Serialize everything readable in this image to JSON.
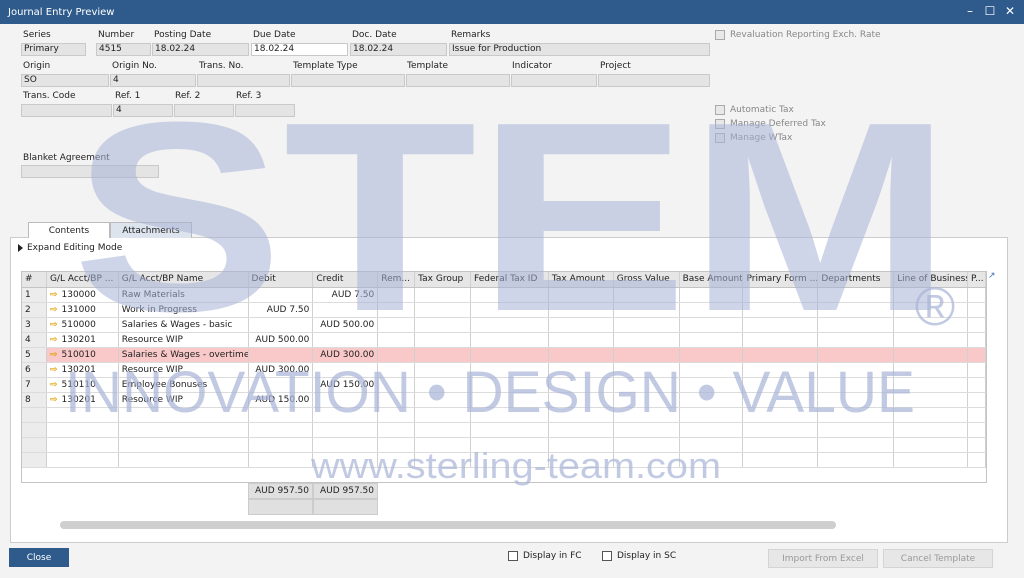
{
  "window": {
    "title": "Journal Entry Preview"
  },
  "header": {
    "labels": {
      "series": "Series",
      "number": "Number",
      "posting_date": "Posting Date",
      "due_date": "Due Date",
      "doc_date": "Doc. Date",
      "remarks": "Remarks",
      "origin": "Origin",
      "origin_no": "Origin No.",
      "trans_no": "Trans. No.",
      "template_type": "Template Type",
      "template": "Template",
      "indicator": "Indicator",
      "project": "Project",
      "trans_code": "Trans. Code",
      "ref1": "Ref. 1",
      "ref2": "Ref. 2",
      "ref3": "Ref. 3",
      "blanket_agreement": "Blanket Agreement"
    },
    "values": {
      "series": "Primary",
      "number": "4515",
      "posting_date": "18.02.24",
      "due_date": "18.02.24",
      "doc_date": "18.02.24",
      "remarks": "Issue for Production",
      "origin": "SO",
      "origin_no": "4",
      "trans_no": "",
      "template_type": "",
      "template": "",
      "indicator": "",
      "project": "",
      "trans_code": "",
      "ref1": "4",
      "ref2": "",
      "ref3": "",
      "blanket_agreement": ""
    }
  },
  "options": {
    "revaluation": "Revaluation Reporting Exch. Rate",
    "automatic_tax": "Automatic Tax",
    "manage_deferred_tax": "Manage Deferred Tax",
    "manage_wtax": "Manage WTax"
  },
  "tabs": [
    "Contents",
    "Attachments"
  ],
  "expand_label": "Expand Editing Mode",
  "table": {
    "columns": [
      "#",
      "G/L Acct/BP ...",
      "G/L Acct/BP Name",
      "Debit",
      "Credit",
      "Rem...",
      "Tax Group",
      "Federal Tax ID",
      "Tax Amount",
      "Gross Value",
      "Base Amount",
      "Primary Form ...",
      "Departments",
      "Line of Business",
      "P..."
    ],
    "rows": [
      {
        "n": "1",
        "code": "130000",
        "name": "Raw Materials",
        "debit": "",
        "credit": "AUD 7.50"
      },
      {
        "n": "2",
        "code": "131000",
        "name": "Work in Progress",
        "debit": "AUD 7.50",
        "credit": ""
      },
      {
        "n": "3",
        "code": "510000",
        "name": "Salaries & Wages - basic",
        "debit": "",
        "credit": "AUD 500.00"
      },
      {
        "n": "4",
        "code": "130201",
        "name": "Resource WIP",
        "debit": "AUD 500.00",
        "credit": ""
      },
      {
        "n": "5",
        "code": "510010",
        "name": "Salaries & Wages - overtime",
        "debit": "",
        "credit": "AUD 300.00"
      },
      {
        "n": "6",
        "code": "130201",
        "name": "Resource WIP",
        "debit": "AUD 300.00",
        "credit": ""
      },
      {
        "n": "7",
        "code": "510110",
        "name": "Employee Bonuses",
        "debit": "",
        "credit": "AUD 150.00"
      },
      {
        "n": "8",
        "code": "130201",
        "name": "Resource WIP",
        "debit": "AUD 150.00",
        "credit": ""
      }
    ],
    "totals": {
      "debit": "AUD 957.50",
      "credit": "AUD 957.50"
    }
  },
  "footer": {
    "close": "Close",
    "display_fc": "Display in FC",
    "display_sc": "Display in SC",
    "import_excel": "Import From Excel",
    "cancel_template": "Cancel Template"
  },
  "watermark": {
    "logo": "STEM",
    "registered": "®",
    "tagline": "INNOVATION • DESIGN • VALUE",
    "url": "www.sterling-team.com"
  }
}
